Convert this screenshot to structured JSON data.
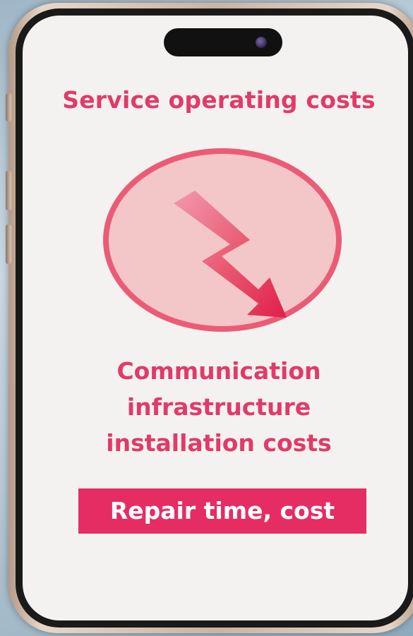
{
  "phone": {
    "title": "Service operating costs",
    "description_lines": [
      "Communication",
      "infrastructure",
      "installation costs"
    ],
    "tag_label": "Repair time, cost",
    "icon": "down-zigzag-arrow-icon",
    "colors": {
      "accent": "#e23a68",
      "tag_bg": "#e52d63",
      "circle_fill": "#f3c7c8",
      "circle_border": "#ec5b76",
      "screen_bg": "#f4f2f1"
    }
  }
}
